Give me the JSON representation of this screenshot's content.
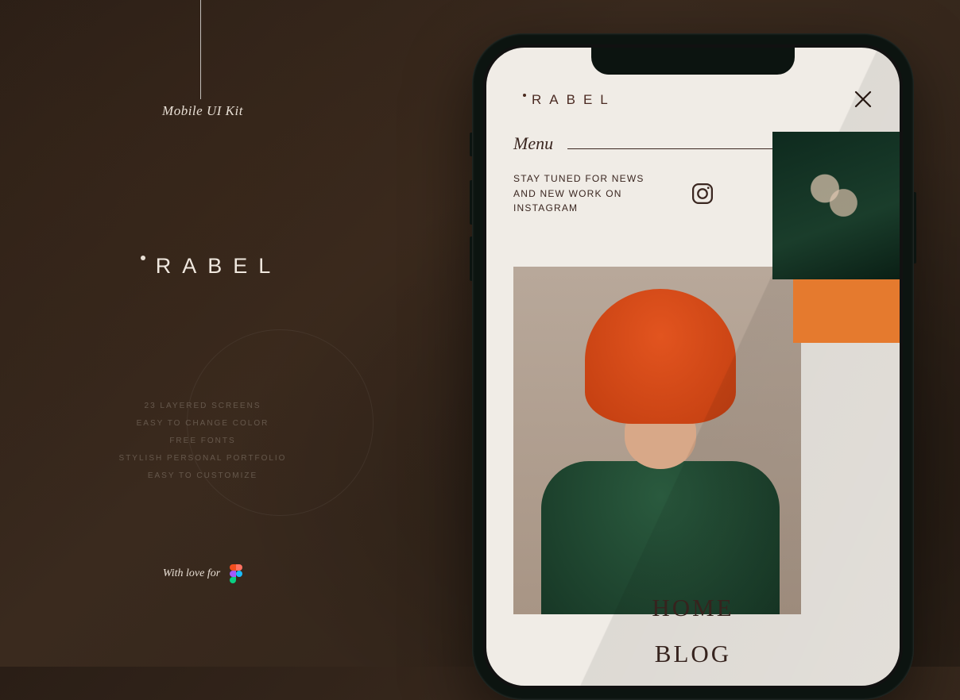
{
  "left": {
    "subtitle": "Mobile UI Kit",
    "brand": "RABEL",
    "features": [
      "23 LAYERED SCREENS",
      "EASY TO CHANGE COLOR",
      "FREE FONTS",
      "STYLISH PERSONAL PORTFOLIO",
      "EASY TO CUSTOMIZE"
    ],
    "with_love": "With love for"
  },
  "app": {
    "brand": "RABEL",
    "menu_label": "Menu",
    "instagram_text": "STAY TUNED FOR NEWS AND NEW WORK ON INSTAGRAM",
    "nav": [
      "HOME",
      "BLOG"
    ]
  },
  "colors": {
    "accent": "#e06520",
    "dark": "#3a2620"
  }
}
